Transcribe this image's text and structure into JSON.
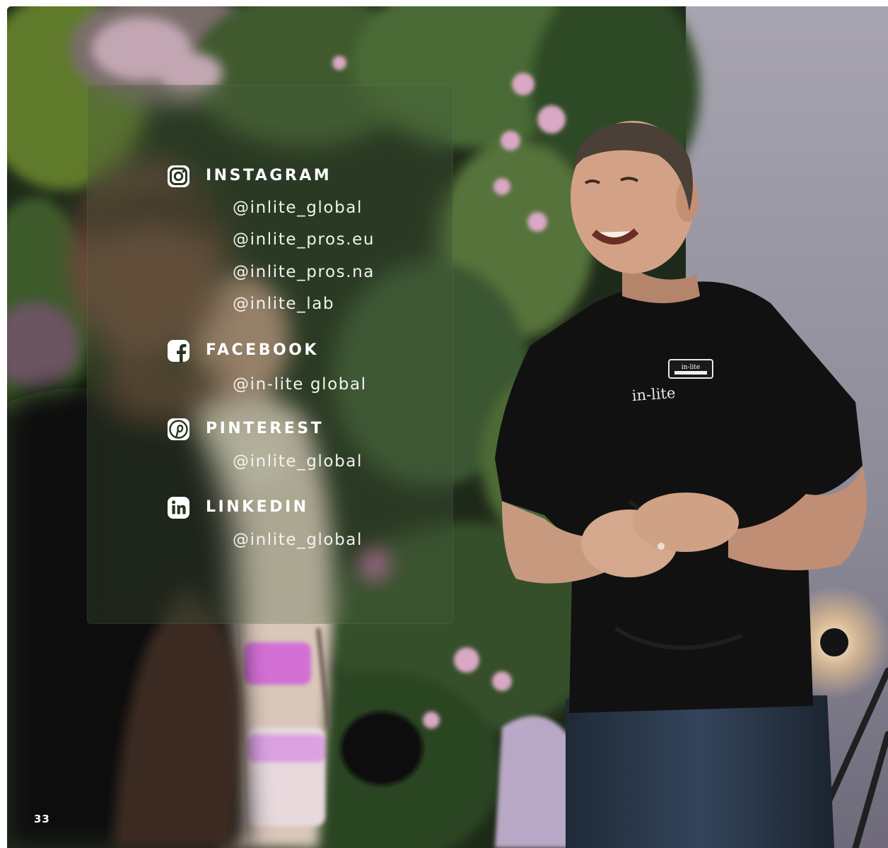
{
  "socials": [
    {
      "icon": "instagram-icon",
      "title": "INSTAGRAM",
      "handles": [
        "@inlite_global",
        "@inlite_pros.eu",
        "@inlite_pros.na",
        "@inlite_lab"
      ]
    },
    {
      "icon": "facebook-icon",
      "title": "FACEBOOK",
      "handles": [
        "@in-lite global"
      ]
    },
    {
      "icon": "pinterest-icon",
      "title": "PINTEREST",
      "handles": [
        "@inlite_global"
      ]
    },
    {
      "icon": "linkedin-icon",
      "title": "LINKEDIN",
      "handles": [
        "@inlite_global"
      ]
    }
  ],
  "page_number": "33",
  "photo": {
    "shirt_logo": "in-lite",
    "name_badge": "in-lite"
  },
  "colors": {
    "text": "#ffffff",
    "panel_tint": "#465c3a",
    "foliage_dark": "#1d2618",
    "wall": "#8f8c99",
    "shirt": "#101010",
    "pink_light": "#d36fd6"
  }
}
